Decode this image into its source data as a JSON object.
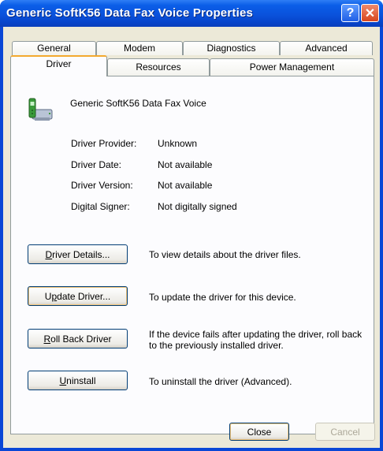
{
  "window": {
    "title": "Generic SoftK56 Data Fax Voice Properties",
    "help_glyph": "?",
    "close_glyph": "✕"
  },
  "tabs": {
    "row1": [
      "General",
      "Modem",
      "Diagnostics",
      "Advanced"
    ],
    "row2": [
      "Driver",
      "Resources",
      "Power Management"
    ],
    "active": "Driver"
  },
  "device": {
    "name": "Generic SoftK56 Data Fax Voice",
    "icon": "modem-phone-icon"
  },
  "info": [
    {
      "label": "Driver Provider:",
      "value": "Unknown"
    },
    {
      "label": "Driver Date:",
      "value": "Not available"
    },
    {
      "label": "Driver Version:",
      "value": "Not available"
    },
    {
      "label": "Digital Signer:",
      "value": "Not digitally signed"
    }
  ],
  "actions": [
    {
      "button": "Driver Details...",
      "accel": "D",
      "desc": "To view details about the driver files."
    },
    {
      "button": "Update Driver...",
      "accel": "p",
      "desc": "To update the driver for this device."
    },
    {
      "button": "Roll Back Driver",
      "accel": "R",
      "desc": "If the device fails after updating the driver, roll back to the previously installed driver."
    },
    {
      "button": "Uninstall",
      "accel": "U",
      "desc": "To uninstall the driver (Advanced)."
    }
  ],
  "footer": {
    "close": "Close",
    "cancel": "Cancel"
  },
  "colors": {
    "title_bar": "#0a52dc",
    "dialog_bg": "#ece9d8",
    "active_tab_accent": "#f3a92e"
  }
}
